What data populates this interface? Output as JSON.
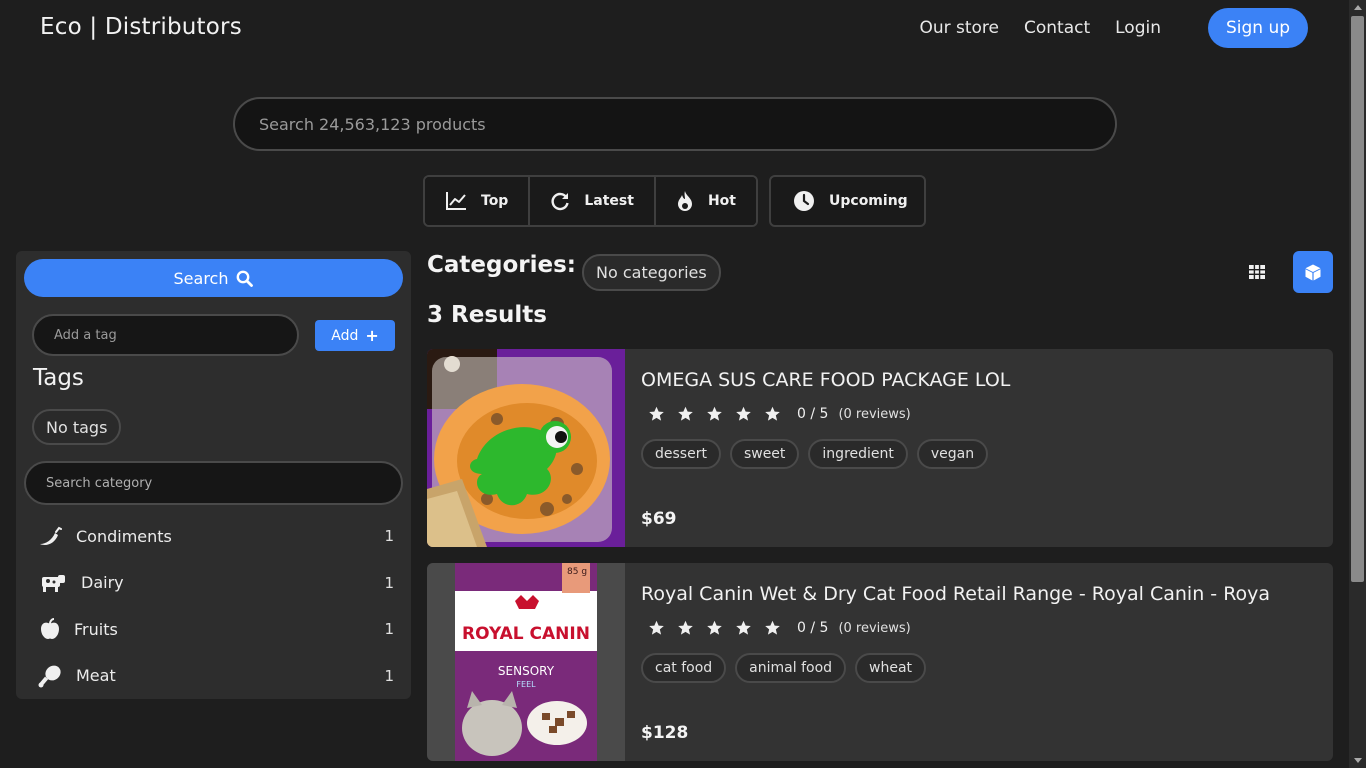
{
  "header": {
    "brand": "Eco | Distributors",
    "nav": [
      "Our store",
      "Contact",
      "Login"
    ],
    "signup": "Sign up"
  },
  "search": {
    "placeholder": "Search 24,563,123 products"
  },
  "sort": {
    "top": "Top",
    "latest": "Latest",
    "hot": "Hot",
    "upcoming": "Upcoming"
  },
  "sidebar": {
    "search_button": "Search",
    "tag_placeholder": "Add a tag",
    "add_button": "Add",
    "tags_title": "Tags",
    "no_tags": "No tags",
    "category_placeholder": "Search category",
    "categories": [
      {
        "label": "Condiments",
        "count": "1",
        "icon": "pepper-icon"
      },
      {
        "label": "Dairy",
        "count": "1",
        "icon": "cow-icon"
      },
      {
        "label": "Fruits",
        "count": "1",
        "icon": "apple-icon"
      },
      {
        "label": "Meat",
        "count": "1",
        "icon": "drumstick-icon"
      }
    ]
  },
  "main": {
    "categories_label": "Categories:",
    "no_categories": "No categories",
    "results": "3 Results"
  },
  "products": [
    {
      "title": "OMEGA SUS CARE FOOD PACKAGE LOL",
      "rating": "0 / 5",
      "reviews": "(0 reviews)",
      "stars": 5,
      "tags": [
        "dessert",
        "sweet",
        "ingredient",
        "vegan"
      ],
      "price": "$69"
    },
    {
      "title": "Royal Canin Wet & Dry Cat Food Retail Range - Royal Canin - Roya",
      "rating": "0 / 5",
      "reviews": "(0 reviews)",
      "stars": 5,
      "tags": [
        "cat food",
        "animal food",
        "wheat"
      ],
      "price": "$128",
      "package_text": {
        "brand": "ROYAL CANIN",
        "line": "SENSORY",
        "sub": "FEEL",
        "weight": "85 g"
      }
    }
  ],
  "colors": {
    "accent": "#3b82f6",
    "background": "#1e1e1e",
    "panel": "#2d2d2d",
    "card": "#333333"
  }
}
